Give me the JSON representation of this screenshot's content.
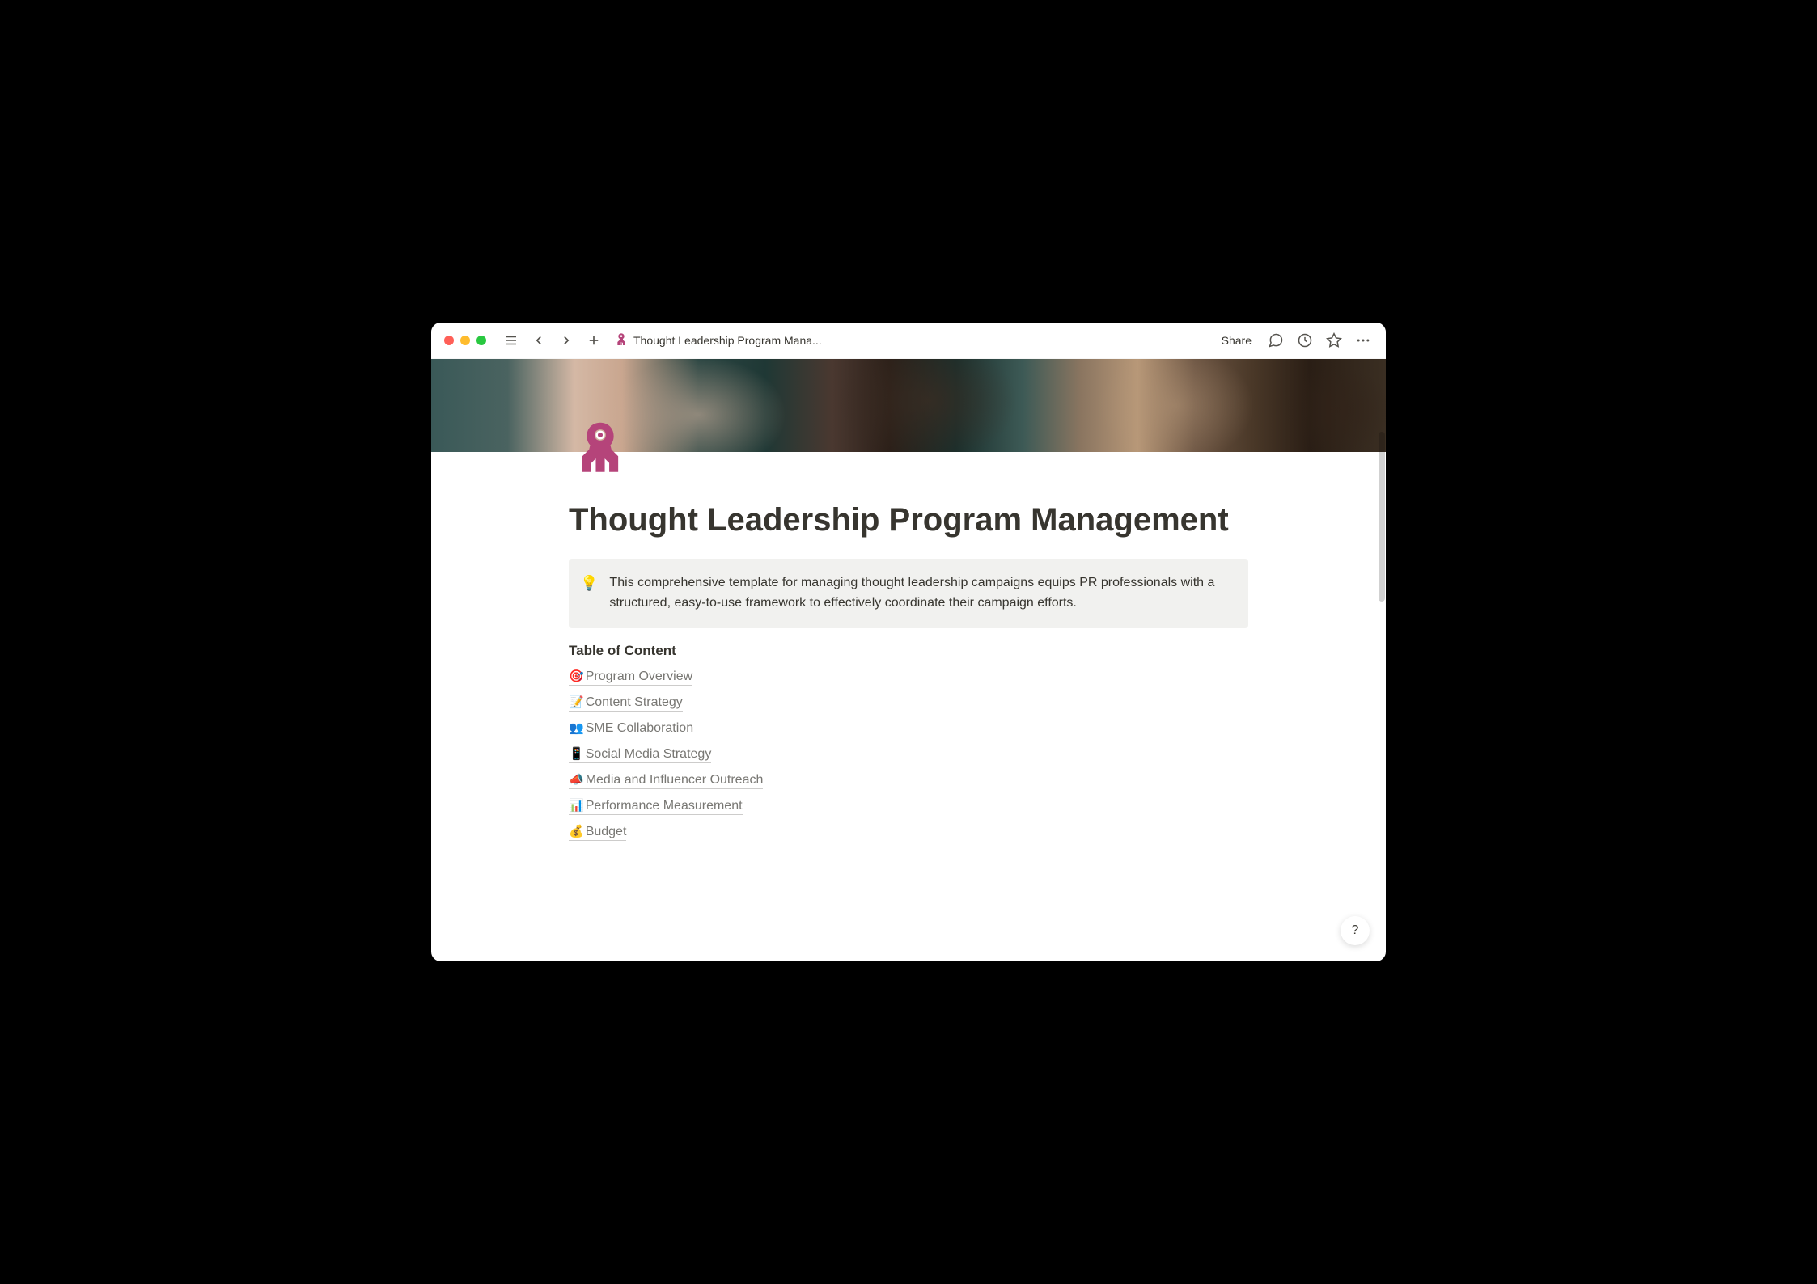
{
  "titlebar": {
    "breadcrumb_title": "Thought Leadership Program Mana...",
    "share_label": "Share"
  },
  "page": {
    "title": "Thought Leadership Program Management",
    "callout_icon": "💡",
    "callout_text": "This comprehensive template for managing thought leadership campaigns equips PR professionals with a structured, easy-to-use framework to effectively coordinate their campaign efforts.",
    "toc_heading": "Table of Content",
    "toc": [
      {
        "emoji": "🎯",
        "label": "Program Overview"
      },
      {
        "emoji": "📝",
        "label": "Content Strategy"
      },
      {
        "emoji": "👥",
        "label": "SME Collaboration"
      },
      {
        "emoji": "📱",
        "label": "Social Media Strategy"
      },
      {
        "emoji": "📣",
        "label": "Media and Influencer Outreach"
      },
      {
        "emoji": "📊",
        "label": "Performance Measurement"
      },
      {
        "emoji": "💰",
        "label": "Budget"
      }
    ]
  },
  "help_label": "?"
}
